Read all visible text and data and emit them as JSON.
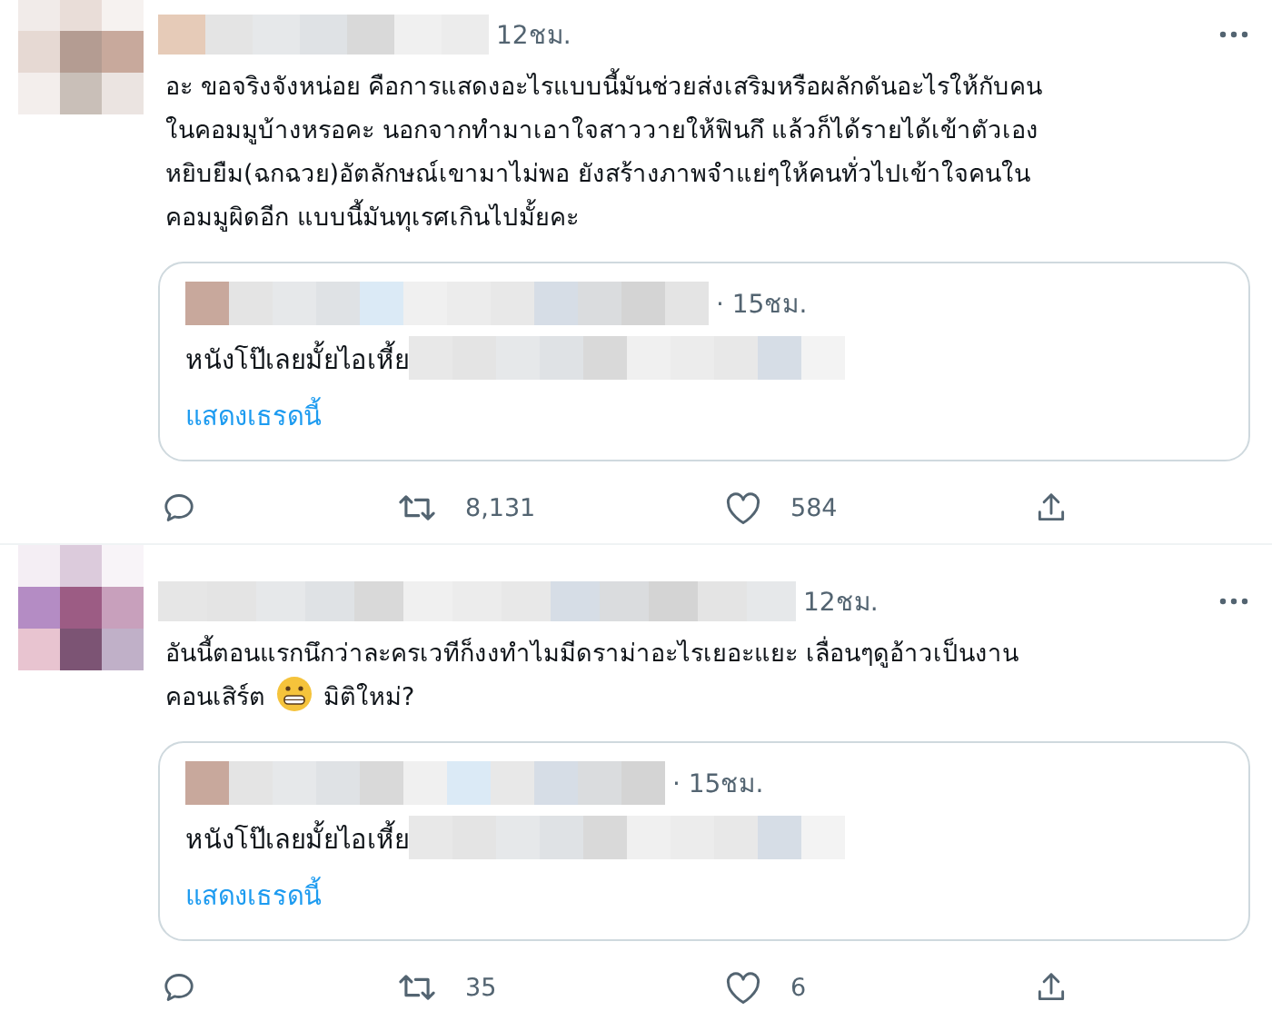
{
  "tweets": [
    {
      "time": "12ชม.",
      "body": [
        [
          {
            "kind": "text",
            "text": "อะ ขอจริงจังหน่อย คือการแสดงอะไรแบบนี้มันช่วยส่งเสริมหรือผลักดันอะไรให้กับคน"
          }
        ],
        [
          {
            "kind": "text",
            "text": "ในคอมมูบ้างหรอคะ นอกจากทำมาเอาใจสาววายให้ฟินกึ แล้วก็ได้รายได้เข้าตัวเอง"
          }
        ],
        [
          {
            "kind": "text",
            "text": "หยิบยืม(ฉกฉวย)อัตลักษณ์เขามาไม่พอ ยังสร้างภาพจำแย่ๆให้คนทั่วไปเข้าใจคนใน"
          }
        ],
        [
          {
            "kind": "text",
            "text": "คอมมูผิดอีก แบบนี้มันทุเรศเกินไปมั้ยคะ"
          }
        ]
      ],
      "quote": {
        "time": "· 15ชม.",
        "text": "หนังโป๊เลยมั้ยไอเหี้ย",
        "link": "แสดงเธรดนี้"
      },
      "retweets": "8,131",
      "likes": "584"
    },
    {
      "time": "12ชม.",
      "body": [
        [
          {
            "kind": "text",
            "text": "อันนี้ตอนแรกนึกว่าละครเวทีก็งงทำไมมีดราม่าอะไรเยอะแยะ เลื่อนๆดูอ้าวเป็นงาน"
          }
        ],
        [
          {
            "kind": "text",
            "text": "คอนเสิร์ต"
          },
          {
            "kind": "emoji"
          },
          {
            "kind": "text",
            "text": "มิติใหม่?"
          }
        ]
      ],
      "quote": {
        "time": "· 15ชม.",
        "text": "หนังโป๊เลยมั้ยไอเหี้ย",
        "link": "แสดงเธรดนี้"
      },
      "retweets": "35",
      "likes": "6"
    }
  ]
}
